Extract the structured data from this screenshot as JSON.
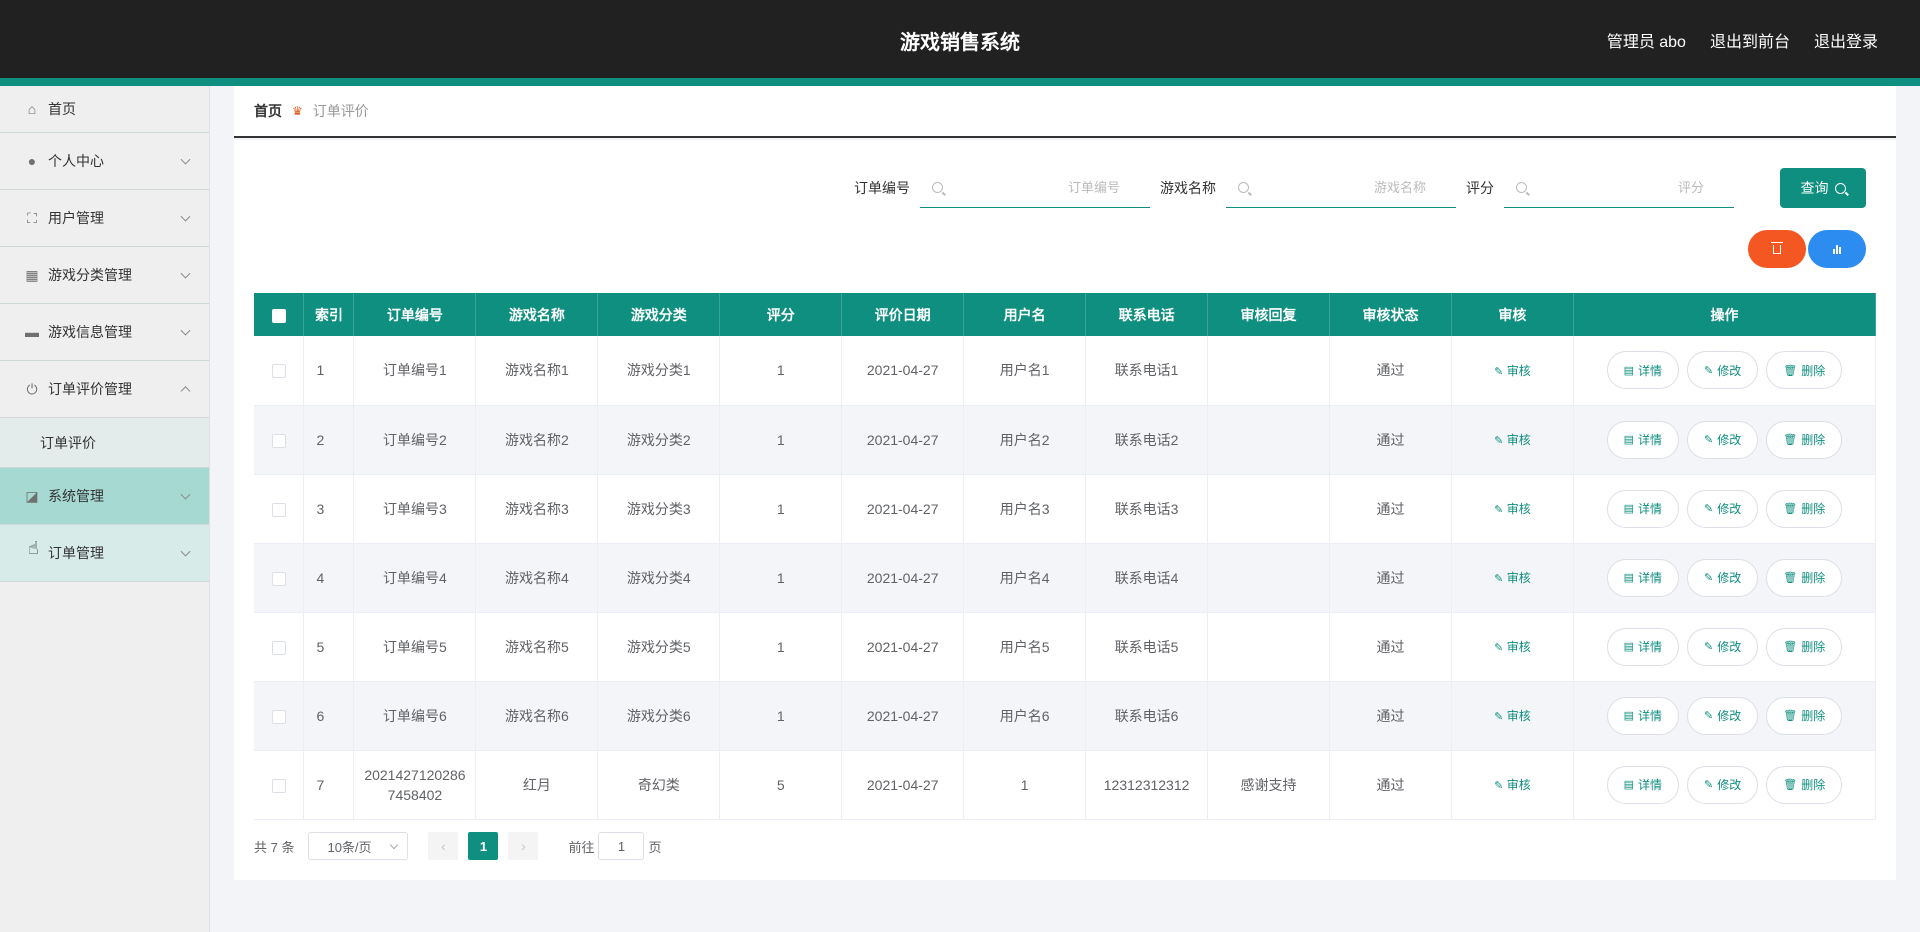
{
  "header": {
    "title": "游戏销售系统",
    "admin": "管理员 abo",
    "to_front": "退出到前台",
    "logout": "退出登录"
  },
  "sidebar": {
    "items": [
      {
        "label": "首页",
        "icon": "home-icon"
      },
      {
        "label": "个人中心",
        "icon": "user-icon"
      },
      {
        "label": "用户管理",
        "icon": "frame-icon"
      },
      {
        "label": "游戏分类管理",
        "icon": "grid-icon"
      },
      {
        "label": "游戏信息管理",
        "icon": "folder-icon"
      },
      {
        "label": "订单评价管理",
        "icon": "power-icon"
      },
      {
        "label": "系统管理",
        "icon": "chart-icon"
      },
      {
        "label": "订单管理",
        "icon": "cart-icon"
      }
    ],
    "submenu": {
      "label": "订单评价"
    }
  },
  "breadcrumb": {
    "home": "首页",
    "current": "订单评价"
  },
  "search": {
    "order_no_label": "订单编号",
    "order_no_placeholder": "订单编号",
    "game_name_label": "游戏名称",
    "game_name_placeholder": "游戏名称",
    "score_label": "评分",
    "score_placeholder": "评分",
    "query_label": "查询"
  },
  "table": {
    "columns": [
      "索引",
      "订单编号",
      "游戏名称",
      "游戏分类",
      "评分",
      "评价日期",
      "用户名",
      "联系电话",
      "审核回复",
      "审核状态",
      "审核",
      "操作"
    ],
    "audit_label": "审核",
    "detail_label": "详情",
    "edit_label": "修改",
    "delete_label": "删除",
    "rows": [
      {
        "index": "1",
        "order_no": "订单编号1",
        "game_name": "游戏名称1",
        "category": "游戏分类1",
        "score": "1",
        "date": "2021-04-27",
        "username": "用户名1",
        "phone": "联系电话1",
        "reply": "",
        "status": "通过"
      },
      {
        "index": "2",
        "order_no": "订单编号2",
        "game_name": "游戏名称2",
        "category": "游戏分类2",
        "score": "1",
        "date": "2021-04-27",
        "username": "用户名2",
        "phone": "联系电话2",
        "reply": "",
        "status": "通过"
      },
      {
        "index": "3",
        "order_no": "订单编号3",
        "game_name": "游戏名称3",
        "category": "游戏分类3",
        "score": "1",
        "date": "2021-04-27",
        "username": "用户名3",
        "phone": "联系电话3",
        "reply": "",
        "status": "通过"
      },
      {
        "index": "4",
        "order_no": "订单编号4",
        "game_name": "游戏名称4",
        "category": "游戏分类4",
        "score": "1",
        "date": "2021-04-27",
        "username": "用户名4",
        "phone": "联系电话4",
        "reply": "",
        "status": "通过"
      },
      {
        "index": "5",
        "order_no": "订单编号5",
        "game_name": "游戏名称5",
        "category": "游戏分类5",
        "score": "1",
        "date": "2021-04-27",
        "username": "用户名5",
        "phone": "联系电话5",
        "reply": "",
        "status": "通过"
      },
      {
        "index": "6",
        "order_no": "订单编号6",
        "game_name": "游戏名称6",
        "category": "游戏分类6",
        "score": "1",
        "date": "2021-04-27",
        "username": "用户名6",
        "phone": "联系电话6",
        "reply": "",
        "status": "通过"
      },
      {
        "index": "7",
        "order_no": "20214271202867458402",
        "game_name": "红月",
        "category": "奇幻类",
        "score": "5",
        "date": "2021-04-27",
        "username": "1",
        "phone": "12312312312",
        "reply": "感谢支持",
        "status": "通过"
      }
    ]
  },
  "pagination": {
    "total": "共 7 条",
    "page_size": "10条/页",
    "current_page": "1",
    "goto_prefix": "前往",
    "goto_value": "1",
    "goto_suffix": "页"
  },
  "colors": {
    "accent": "#0f8f7f",
    "danger": "#f45722",
    "primary": "#2d8cf0",
    "header_bg": "#212121"
  }
}
